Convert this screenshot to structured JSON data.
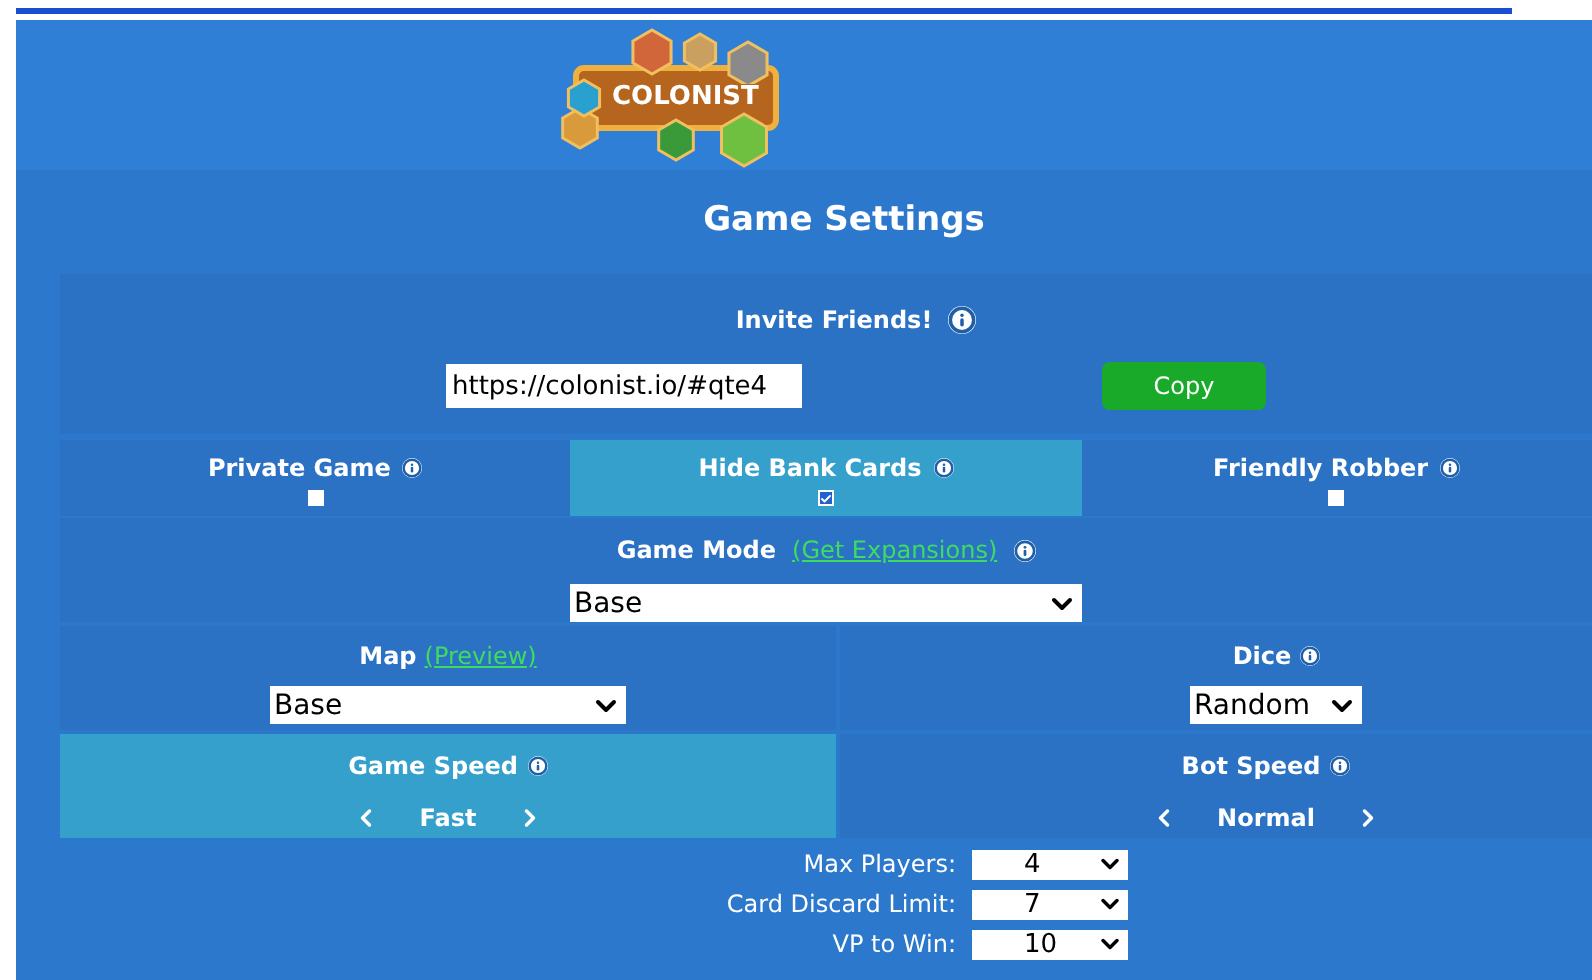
{
  "logo": {
    "text": "COLONIST"
  },
  "title": "Game Settings",
  "invite": {
    "label": "Invite Friends!",
    "url": "https://colonist.io/#qte4",
    "button": "Copy"
  },
  "toggles": [
    {
      "label": "Private Game",
      "checked": false,
      "highlighted": false
    },
    {
      "label": "Hide Bank Cards",
      "checked": true,
      "highlighted": true
    },
    {
      "label": "Friendly Robber",
      "checked": false,
      "highlighted": false
    }
  ],
  "game_mode": {
    "label": "Game Mode",
    "link": "(Get Expansions)",
    "value": "Base"
  },
  "map": {
    "label": "Map",
    "link": "(Preview)",
    "value": "Base"
  },
  "dice": {
    "label": "Dice",
    "value": "Random"
  },
  "speeds": [
    {
      "label": "Game Speed",
      "value": "Fast",
      "highlighted": true
    },
    {
      "label": "Bot Speed",
      "value": "Normal",
      "highlighted": false
    }
  ],
  "limits": [
    {
      "label": "Max Players:",
      "value": "4"
    },
    {
      "label": "Card Discard Limit:",
      "value": "7"
    },
    {
      "label": "VP to Win:",
      "value": "10"
    }
  ]
}
